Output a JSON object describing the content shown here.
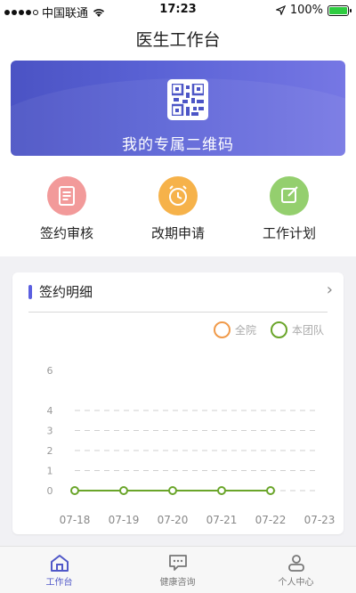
{
  "status_bar": {
    "carrier": "中国联通",
    "time": "17:23",
    "battery": "100%"
  },
  "header": {
    "title": "医生工作台"
  },
  "qr_banner": {
    "label": "我的专属二维码",
    "icon": "qr-code-icon"
  },
  "quick_actions": [
    {
      "label": "签约审核",
      "icon": "document-list-icon",
      "color": "#f29a9a"
    },
    {
      "label": "改期申请",
      "icon": "alarm-clock-icon",
      "color": "#f6b24a"
    },
    {
      "label": "工作计划",
      "icon": "edit-note-icon",
      "color": "#94cf6e"
    }
  ],
  "sign_detail": {
    "title": "签约明细",
    "legend": [
      {
        "label": "全院",
        "color": "#f09a4a"
      },
      {
        "label": "本团队",
        "color": "#6aa52a"
      }
    ]
  },
  "chart_data": {
    "type": "line",
    "x": [
      "07-18",
      "07-19",
      "07-20",
      "07-21",
      "07-22",
      "07-23"
    ],
    "series": [
      {
        "name": "本团队",
        "values": [
          0,
          0,
          0,
          0,
          0,
          0
        ],
        "color": "#6aa52a"
      }
    ],
    "ylim": [
      0,
      6
    ],
    "yticks": [
      0,
      1,
      2,
      3,
      4,
      6
    ],
    "grid": true,
    "legend_position": "top-right"
  },
  "tabbar": [
    {
      "label": "工作台",
      "icon": "home-icon",
      "active": true
    },
    {
      "label": "健康咨询",
      "icon": "chat-icon",
      "active": false
    },
    {
      "label": "个人中心",
      "icon": "user-icon",
      "active": false
    }
  ]
}
